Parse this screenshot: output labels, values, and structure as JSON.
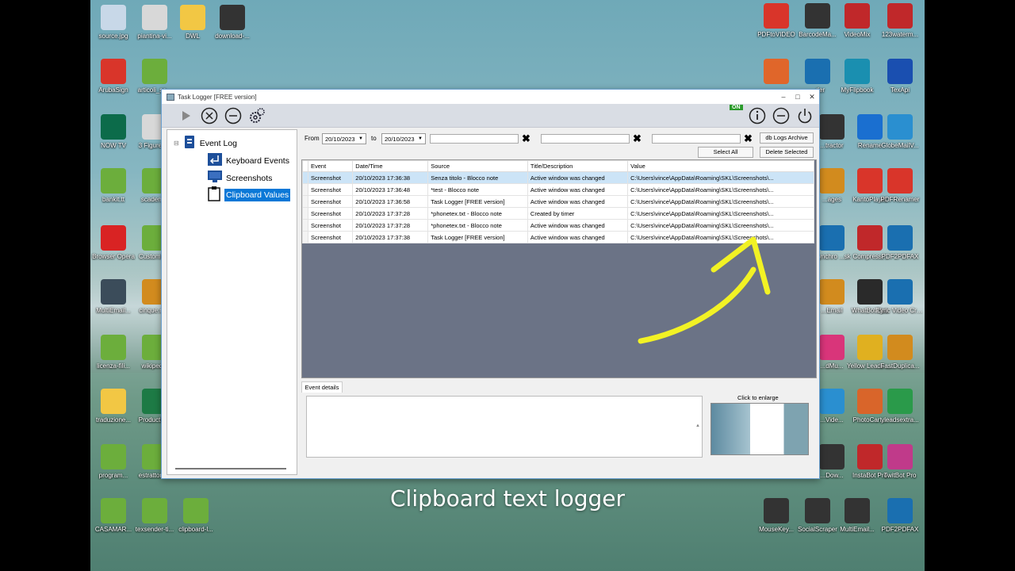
{
  "desktop_icons_left": [
    {
      "label": "source.jpg",
      "color": "#c8d8e8"
    },
    {
      "label": "piantina-vi...",
      "color": "#d8d8d8"
    },
    {
      "label": "DWL",
      "color": "#f2c744"
    },
    {
      "label": "download-...",
      "color": "#333"
    },
    {
      "label": "ArubaSign",
      "color": "#d9352a"
    },
    {
      "label": "articoli_so...",
      "color": "#6cae3c"
    },
    {
      "label": "NOW TV",
      "color": "#0c6b4a"
    },
    {
      "label": "3 Figure8...",
      "color": "#d8d8d8"
    },
    {
      "label": "bankit.tt",
      "color": "#6cae3c"
    },
    {
      "label": "scadenze",
      "color": "#6cae3c"
    },
    {
      "label": "Browser Opera",
      "color": "#d92323"
    },
    {
      "label": "Customiz...",
      "color": "#6cae3c"
    },
    {
      "label": "MultiEmail...",
      "color": "#3b4c5a"
    },
    {
      "label": "cinque.m...",
      "color": "#d28b1e"
    },
    {
      "label": "licenza-fili...",
      "color": "#6cae3c"
    },
    {
      "label": "wikipedia",
      "color": "#6cae3c"
    },
    {
      "label": "traduzione...",
      "color": "#f2c744"
    },
    {
      "label": "ProductLi...",
      "color": "#1d7a45"
    },
    {
      "label": "program...",
      "color": "#6cae3c"
    },
    {
      "label": "estrattore...",
      "color": "#6cae3c"
    },
    {
      "label": "CASAMAR...",
      "color": "#6cae3c"
    },
    {
      "label": "texsender-ti...",
      "color": "#6cae3c"
    },
    {
      "label": "clipboard-l...",
      "color": "#6cae3c"
    }
  ],
  "desktop_icons_right": [
    {
      "label": "PDFtoVIDEO",
      "color": "#d9352a"
    },
    {
      "label": "BarcodeMa...",
      "color": "#333"
    },
    {
      "label": "VideoMix",
      "color": "#c0282a"
    },
    {
      "label": "123waterm...",
      "color": "#c0282a"
    },
    {
      "label": "",
      "color": "#e0662a"
    },
    {
      "label": "...der",
      "color": "#1a6fb0"
    },
    {
      "label": "MyFlipbook",
      "color": "#1a8fb0"
    },
    {
      "label": "TexApi",
      "color": "#1a4fb0"
    },
    {
      "label": "...tractor",
      "color": "#333"
    },
    {
      "label": "Rename",
      "color": "#1a6fd0"
    },
    {
      "label": "GlobeMailV...",
      "color": "#2a8fd0"
    },
    {
      "label": "...ages",
      "color": "#d28b1e"
    },
    {
      "label": "KantoPlayer",
      "color": "#d9352a"
    },
    {
      "label": "PDFRenamer",
      "color": "#d9352a"
    },
    {
      "label": "...ynchro ...sk",
      "color": "#1a6fb0"
    },
    {
      "label": "Compress...",
      "color": "#c0282a"
    },
    {
      "label": "PDF2PDFAX",
      "color": "#1a6fb0"
    },
    {
      "label": "...Email",
      "color": "#d28b1e"
    },
    {
      "label": "WhatBotPlus",
      "color": "#2a2a2a"
    },
    {
      "label": "Lyric Video Creator",
      "color": "#1a6fb0"
    },
    {
      "label": "...dMu...",
      "color": "#d9357a"
    },
    {
      "label": "Yellow Leads Extractor",
      "color": "#e0b020"
    },
    {
      "label": "FastDuplica...",
      "color": "#d28b1e"
    },
    {
      "label": "...Vide...",
      "color": "#2a8fd0"
    },
    {
      "label": "PhotoCart...",
      "color": "#d9652a"
    },
    {
      "label": "yleadsextra...",
      "color": "#2a9a4a"
    },
    {
      "label": "...Dow...",
      "color": "#333"
    },
    {
      "label": "InstaBot Pro",
      "color": "#c0282a"
    },
    {
      "label": "TwitBot Pro",
      "color": "#c03a8a"
    },
    {
      "label": "MouseKey...",
      "color": "#333"
    },
    {
      "label": "SocialScraper",
      "color": "#333"
    },
    {
      "label": "MultiEmail...",
      "color": "#333"
    },
    {
      "label": "PDF2PDFAX",
      "color": "#1a6fb0"
    }
  ],
  "window": {
    "title": "Task Logger [FREE version]",
    "on_badge": "ON",
    "tree": {
      "root": "Event Log",
      "children": [
        "Keyboard Events",
        "Screenshots",
        "Clipboard Values"
      ],
      "selected_index": 2
    },
    "filters": {
      "from_label": "From",
      "from_value": "20/10/2023",
      "to_label": "to",
      "to_value": "20/10/2023",
      "logs_archive": "db Logs Archive",
      "select_all": "Select All",
      "delete_selected": "Delete Selected"
    },
    "table": {
      "columns": [
        "Event",
        "Date/Time",
        "Source",
        "Title/Description",
        "Value"
      ],
      "rows": [
        [
          "Screenshot",
          "20/10/2023 17:36:38",
          "Senza titolo - Blocco note",
          "Active window was changed",
          "C:\\Users\\vince\\AppData\\Roaming\\SKL\\Screenshots\\..."
        ],
        [
          "Screenshot",
          "20/10/2023 17:36:48",
          "*test - Blocco note",
          "Active window was changed",
          "C:\\Users\\vince\\AppData\\Roaming\\SKL\\Screenshots\\..."
        ],
        [
          "Screenshot",
          "20/10/2023 17:36:58",
          "Task Logger [FREE version]",
          "Active window was changed",
          "C:\\Users\\vince\\AppData\\Roaming\\SKL\\Screenshots\\..."
        ],
        [
          "Screenshot",
          "20/10/2023 17:37:28",
          "*phonetex.txt - Blocco note",
          "Created by timer",
          "C:\\Users\\vince\\AppData\\Roaming\\SKL\\Screenshots\\..."
        ],
        [
          "Screenshot",
          "20/10/2023 17:37:28",
          "*phonetex.txt - Blocco note",
          "Active window was changed",
          "C:\\Users\\vince\\AppData\\Roaming\\SKL\\Screenshots\\..."
        ],
        [
          "Screenshot",
          "20/10/2023 17:37:38",
          "Task Logger [FREE version]",
          "Active window was changed",
          "C:\\Users\\vince\\AppData\\Roaming\\SKL\\Screenshots\\..."
        ]
      ],
      "selected_row": 0
    },
    "details": {
      "tab": "Event details",
      "enlarge": "Click to enlarge"
    }
  },
  "caption": "Clipboard text logger",
  "colors": {
    "selection": "#0a78d7",
    "row_selection": "#cce4f7",
    "arrow": "#f2f224",
    "grid_bg": "#6b7386"
  }
}
